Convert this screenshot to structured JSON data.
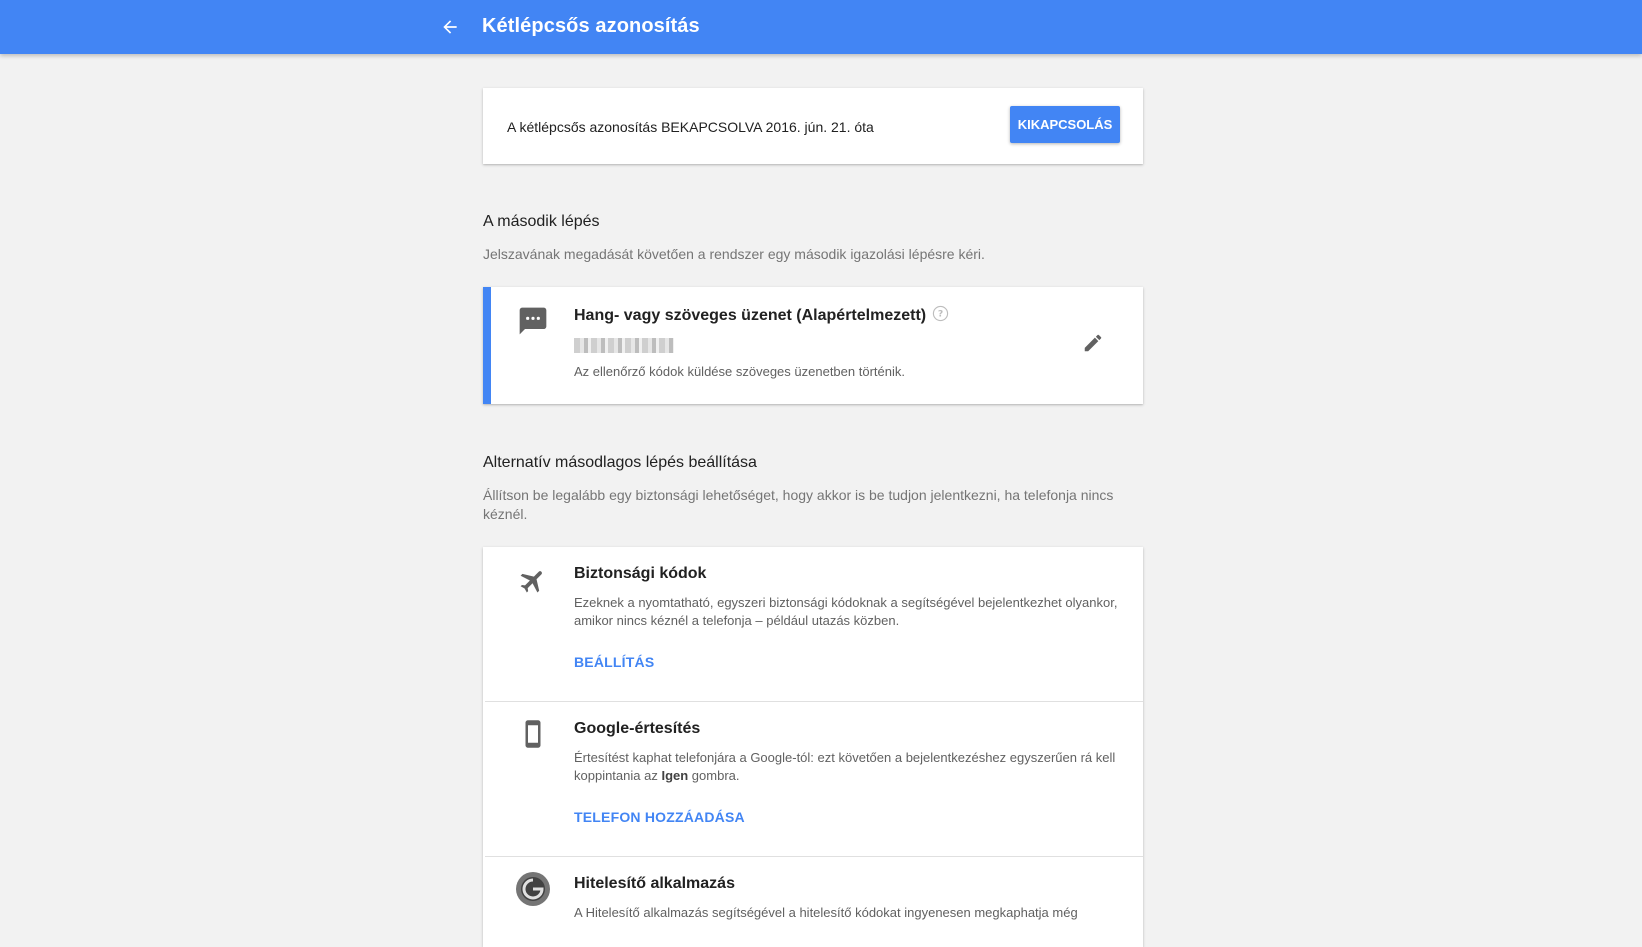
{
  "header": {
    "title": "Kétlépcsős azonosítás",
    "back_icon": "arrow-back-icon",
    "color": "#4285f4"
  },
  "status": {
    "text": "A kétlépcsős azonosítás BEKAPCSOLVA 2016. jún. 21. óta",
    "button_label": "KIKAPCSOLÁS"
  },
  "second_step": {
    "title": "A második lépés",
    "description": "Jelszavának megadását követően a rendszer egy második igazolási lépésre kéri.",
    "option": {
      "icon": "sms-icon",
      "title": "Hang- vagy szöveges üzenet (Alapértelmezett)",
      "detail": "Az ellenőrző kódok küldése szöveges üzenetben történik."
    }
  },
  "alternative": {
    "title": "Alternatív másodlagos lépés beállítása",
    "description": "Állítson be legalább egy biztonsági lehetőséget, hogy akkor is be tudjon jelentkezni, ha telefonja nincs kéznél.",
    "options": [
      {
        "icon": "airplane-icon",
        "title": "Biztonsági kódok",
        "description": "Ezeknek a nyomtatható, egyszeri biztonsági kódoknak a segítségével bejelentkezhet olyankor, amikor nincs kéznél a telefonja – például utazás közben.",
        "action": "BEÁLLÍTÁS"
      },
      {
        "icon": "phone-icon",
        "title": "Google-értesítés",
        "description_pre": "Értesítést kaphat telefonjára a Google-tól: ezt követően a bejelentkezéshez egyszerűen rá kell koppintania az ",
        "description_bold": "Igen",
        "description_post": " gombra.",
        "action": "TELEFON HOZZÁADÁSA"
      },
      {
        "icon": "authenticator-icon",
        "title": "Hitelesítő alkalmazás",
        "description": "A Hitelesítő alkalmazás segítségével a hitelesítő kódokat ingyenesen megkaphatja még"
      }
    ]
  }
}
